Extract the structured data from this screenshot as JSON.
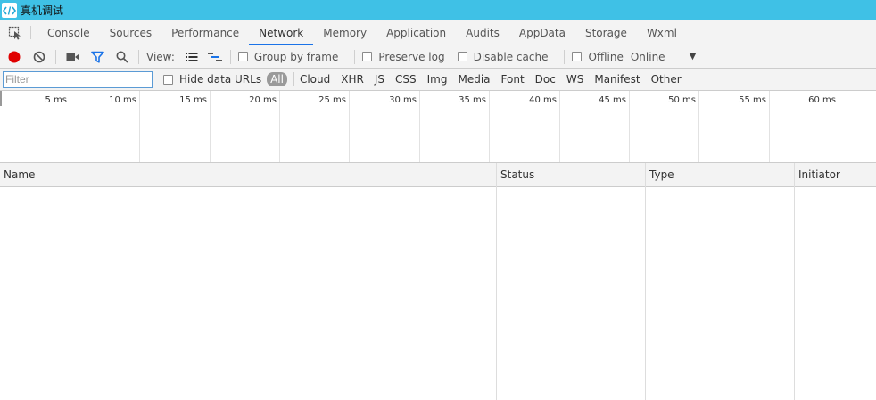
{
  "window": {
    "title": "真机调试"
  },
  "tabs": [
    {
      "label": "Console"
    },
    {
      "label": "Sources"
    },
    {
      "label": "Performance"
    },
    {
      "label": "Network",
      "active": true
    },
    {
      "label": "Memory"
    },
    {
      "label": "Application"
    },
    {
      "label": "Audits"
    },
    {
      "label": "AppData"
    },
    {
      "label": "Storage"
    },
    {
      "label": "Wxml"
    }
  ],
  "toolbar": {
    "view_label": "View:",
    "group_by_frame": "Group by frame",
    "preserve_log": "Preserve log",
    "disable_cache": "Disable cache",
    "offline": "Offline",
    "throttle": "Online",
    "throttle_arrow": "▼"
  },
  "filter": {
    "placeholder": "Filter",
    "hide_data_urls": "Hide data URLs",
    "all": "All",
    "types": [
      "Cloud",
      "XHR",
      "JS",
      "CSS",
      "Img",
      "Media",
      "Font",
      "Doc",
      "WS",
      "Manifest",
      "Other"
    ]
  },
  "overview": {
    "ticks": [
      "5 ms",
      "10 ms",
      "15 ms",
      "20 ms",
      "25 ms",
      "30 ms",
      "35 ms",
      "40 ms",
      "45 ms",
      "50 ms",
      "55 ms",
      "60 ms"
    ]
  },
  "table": {
    "columns": [
      "Name",
      "Status",
      "Type",
      "Initiator"
    ]
  },
  "colors": {
    "titlebar": "#3fc1e6",
    "record": "#e00000",
    "accent": "#1a73e8"
  }
}
